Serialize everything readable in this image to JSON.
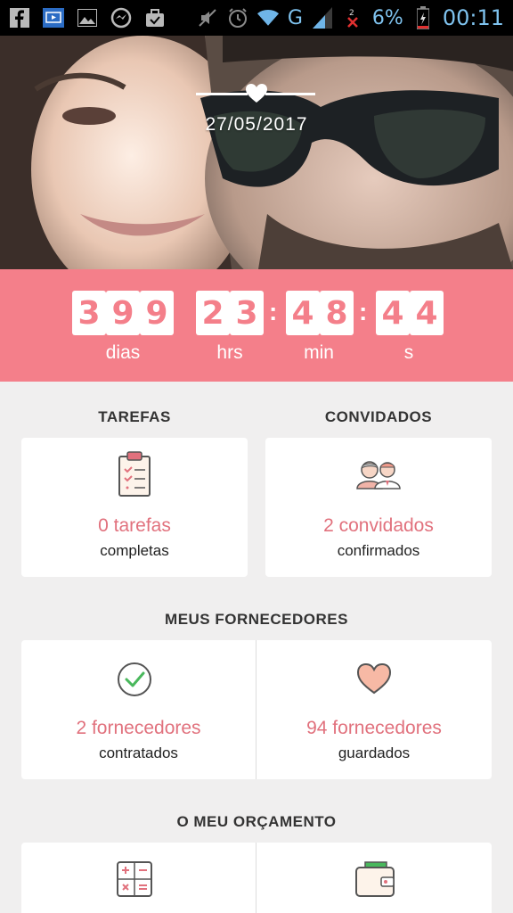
{
  "status_bar": {
    "battery": "6%",
    "time": "00:11",
    "network": "G",
    "icons": [
      "facebook-icon",
      "video-icon",
      "gallery-icon",
      "messenger-icon",
      "work-bag-icon",
      "mute-icon",
      "alarm-icon",
      "wifi-icon",
      "signal-icon",
      "no-sim-icon",
      "battery-icon"
    ]
  },
  "hero": {
    "date": "27/05/2017"
  },
  "countdown": {
    "days": [
      "3",
      "9",
      "9"
    ],
    "hours": [
      "2",
      "3"
    ],
    "minutes": [
      "4",
      "8"
    ],
    "seconds": [
      "4",
      "4"
    ],
    "labels": {
      "days": "dias",
      "hours": "hrs",
      "minutes": "min",
      "seconds": "s"
    },
    "separator": ":"
  },
  "tasks": {
    "title": "TAREFAS",
    "value": "0 tarefas",
    "sub": "completas",
    "icon": "clipboard-checklist-icon"
  },
  "guests": {
    "title": "CONVIDADOS",
    "value": "2 convidados",
    "sub": "confirmados",
    "icon": "couple-icon"
  },
  "suppliers": {
    "title": "MEUS FORNECEDORES",
    "hired": {
      "value": "2 fornecedores",
      "sub": "contratados",
      "icon": "check-circle-icon"
    },
    "saved": {
      "value": "94 fornecedores",
      "sub": "guardados",
      "icon": "heart-icon"
    }
  },
  "budget": {
    "title": "O MEU ORÇAMENTO",
    "icons": [
      "calculator-icon",
      "wallet-icon"
    ]
  },
  "colors": {
    "accent": "#f47f8a",
    "value_text": "#e1717d",
    "background": "#f0efef",
    "status_icons": "#6fb5e8"
  }
}
